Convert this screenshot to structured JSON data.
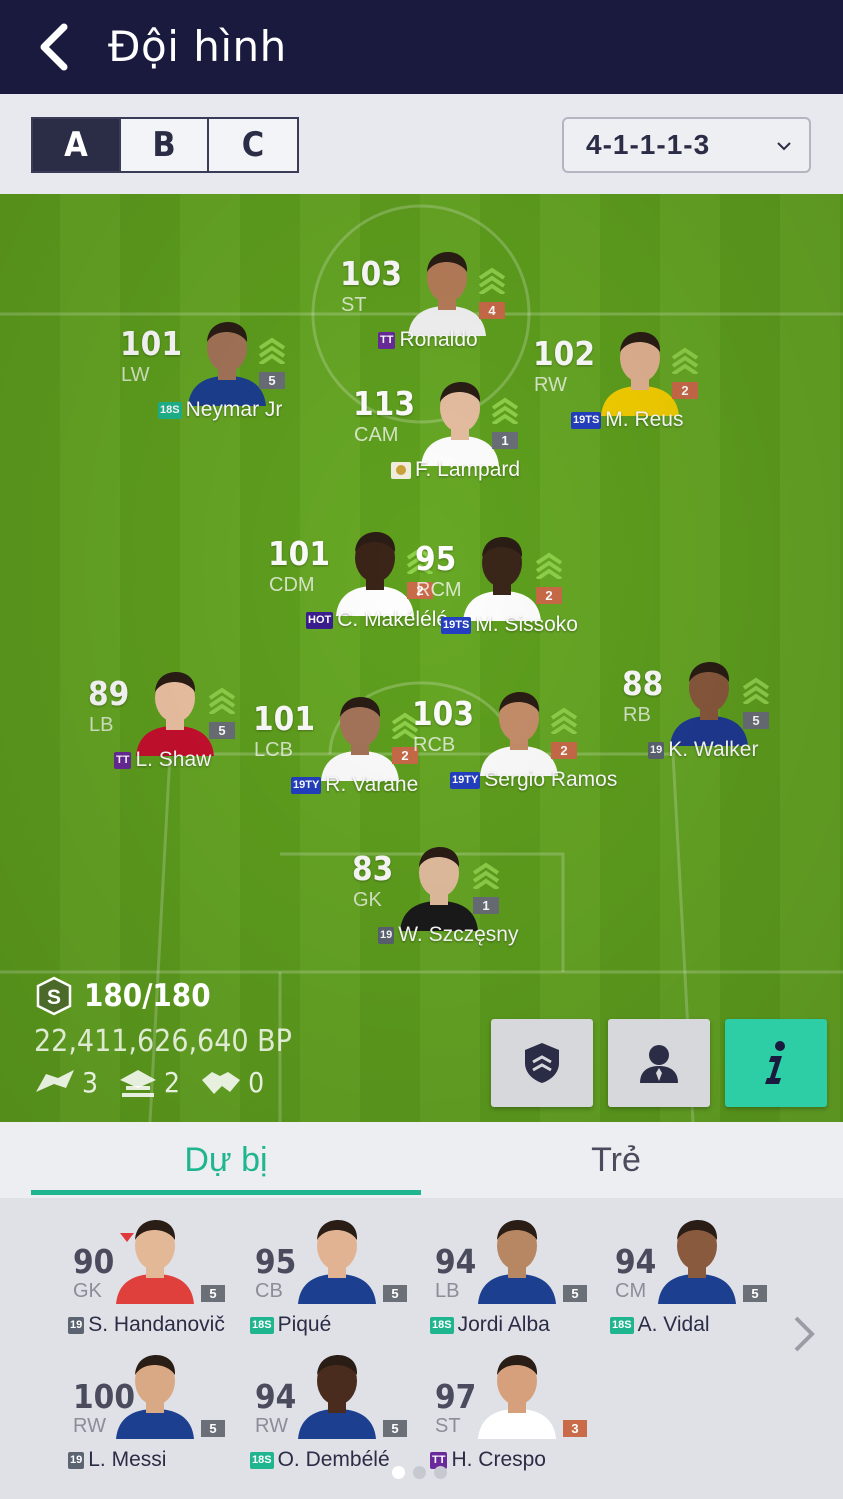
{
  "header": {
    "title": "Đội hình"
  },
  "squad_tabs": [
    "A",
    "B",
    "C"
  ],
  "active_squad": "A",
  "formation": "4-1-1-1-3",
  "lineup": [
    {
      "ovr": "103",
      "pos": "ST",
      "name": "Ronaldo",
      "season": "TT",
      "season_color": "#6a2a9b",
      "level": "4",
      "level_color": "#c96b48"
    },
    {
      "ovr": "101",
      "pos": "LW",
      "name": "Neymar Jr",
      "season": "18S",
      "season_color": "#1fb58e",
      "level": "5",
      "level_color": "#6b6f77"
    },
    {
      "ovr": "102",
      "pos": "RW",
      "name": "M. Reus",
      "season": "19TS",
      "season_color": "#2440c2",
      "level": "2",
      "level_color": "#c96b48"
    },
    {
      "ovr": "113",
      "pos": "CAM",
      "name": "F. Lampard",
      "season": "ICON",
      "season_color": "#e8e0c0",
      "level": "1",
      "level_color": "#6b6f77"
    },
    {
      "ovr": "101",
      "pos": "CDM",
      "name": "C. Makélélé",
      "season": "HOT",
      "season_color": "#3b1e8f",
      "level": "2",
      "level_color": "#c96b48"
    },
    {
      "ovr": "95",
      "pos": "RCM",
      "name": "M. Sissoko",
      "season": "19TS",
      "season_color": "#2440c2",
      "level": "2",
      "level_color": "#c96b48"
    },
    {
      "ovr": "89",
      "pos": "LB",
      "name": "L. Shaw",
      "season": "TT",
      "season_color": "#6a2a9b",
      "level": "5",
      "level_color": "#6b6f77"
    },
    {
      "ovr": "101",
      "pos": "LCB",
      "name": "R. Varane",
      "season": "19TY",
      "season_color": "#2440c2",
      "level": "2",
      "level_color": "#c96b48"
    },
    {
      "ovr": "103",
      "pos": "RCB",
      "name": "Sergio Ramos",
      "season": "19TY",
      "season_color": "#2440c2",
      "level": "2",
      "level_color": "#c96b48"
    },
    {
      "ovr": "88",
      "pos": "RB",
      "name": "K. Walker",
      "season": "19",
      "season_color": "#5c6472",
      "level": "5",
      "level_color": "#6b6f77"
    },
    {
      "ovr": "83",
      "pos": "GK",
      "name": "W. Szczęsny",
      "season": "19",
      "season_color": "#5c6472",
      "level": "1",
      "level_color": "#6b6f77"
    }
  ],
  "team_stats": {
    "salary": "180/180",
    "bp": "22,411,626,640 BP",
    "chem_a": "3",
    "chem_b": "2",
    "chem_c": "0"
  },
  "lower_tabs": [
    "Dự bị",
    "Trẻ"
  ],
  "active_lower_tab": "Dự bị",
  "bench": [
    {
      "ovr": "90",
      "pos": "GK",
      "name": "S. Handanovič",
      "season": "19",
      "season_color": "#5c6472",
      "level": "5",
      "level_color": "#6b6f77",
      "flag_down": true
    },
    {
      "ovr": "95",
      "pos": "CB",
      "name": "Piqué",
      "season": "18S",
      "season_color": "#1fb58e",
      "level": "5",
      "level_color": "#6b6f77",
      "flag_down": false
    },
    {
      "ovr": "94",
      "pos": "LB",
      "name": "Jordi Alba",
      "season": "18S",
      "season_color": "#1fb58e",
      "level": "5",
      "level_color": "#6b6f77",
      "flag_down": false
    },
    {
      "ovr": "94",
      "pos": "CM",
      "name": "A. Vidal",
      "season": "18S",
      "season_color": "#1fb58e",
      "level": "5",
      "level_color": "#6b6f77",
      "flag_down": false
    },
    {
      "ovr": "100",
      "pos": "RW",
      "name": "L. Messi",
      "season": "19",
      "season_color": "#5c6472",
      "level": "5",
      "level_color": "#6b6f77",
      "flag_down": false
    },
    {
      "ovr": "94",
      "pos": "RW",
      "name": "O. Dembélé",
      "season": "18S",
      "season_color": "#1fb58e",
      "level": "5",
      "level_color": "#6b6f77",
      "flag_down": false
    },
    {
      "ovr": "97",
      "pos": "ST",
      "name": "H. Crespo",
      "season": "TT",
      "season_color": "#6a2a9b",
      "level": "3",
      "level_color": "#c96b48",
      "flag_down": false
    }
  ],
  "pagination": {
    "pages": 3,
    "current": 1
  },
  "colors": {
    "header_bg": "#191a3d",
    "accent": "#1fb58e",
    "pitch": "#5fa01e"
  }
}
